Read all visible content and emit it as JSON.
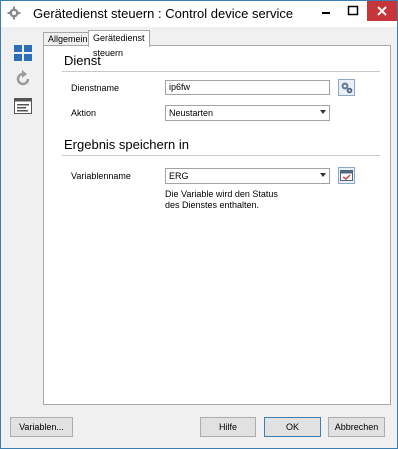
{
  "window": {
    "title": "Gerätedienst steuern : Control device service",
    "app_icon": "gear-icon",
    "controls": [
      "minimize-icon",
      "maximize-icon",
      "close-icon"
    ]
  },
  "sidebar": {
    "icons": [
      "grid-icon",
      "refresh-icon",
      "properties-icon"
    ]
  },
  "tabs": [
    {
      "label": "Allgemein",
      "active": false
    },
    {
      "label": "Gerätedienst steuern",
      "active": true
    }
  ],
  "dienst": {
    "heading": "Dienst",
    "service_label": "Dienstname",
    "service_value": "ip6fw",
    "action_label": "Aktion",
    "action_value": "Neustarten"
  },
  "result": {
    "heading": "Ergebnis speichern in",
    "variable_label": "Variablenname",
    "variable_value": "ERG",
    "hint_line1": "Die Variable wird den Status",
    "hint_line2": "des Dienstes enthalten."
  },
  "buttons": {
    "variables": "Variablen...",
    "help": "Hilfe",
    "ok": "OK",
    "cancel": "Abbrechen"
  },
  "colors": {
    "accent": "#3b7fb0",
    "close": "#c7343a",
    "icon_blue": "#2a6fb8"
  }
}
